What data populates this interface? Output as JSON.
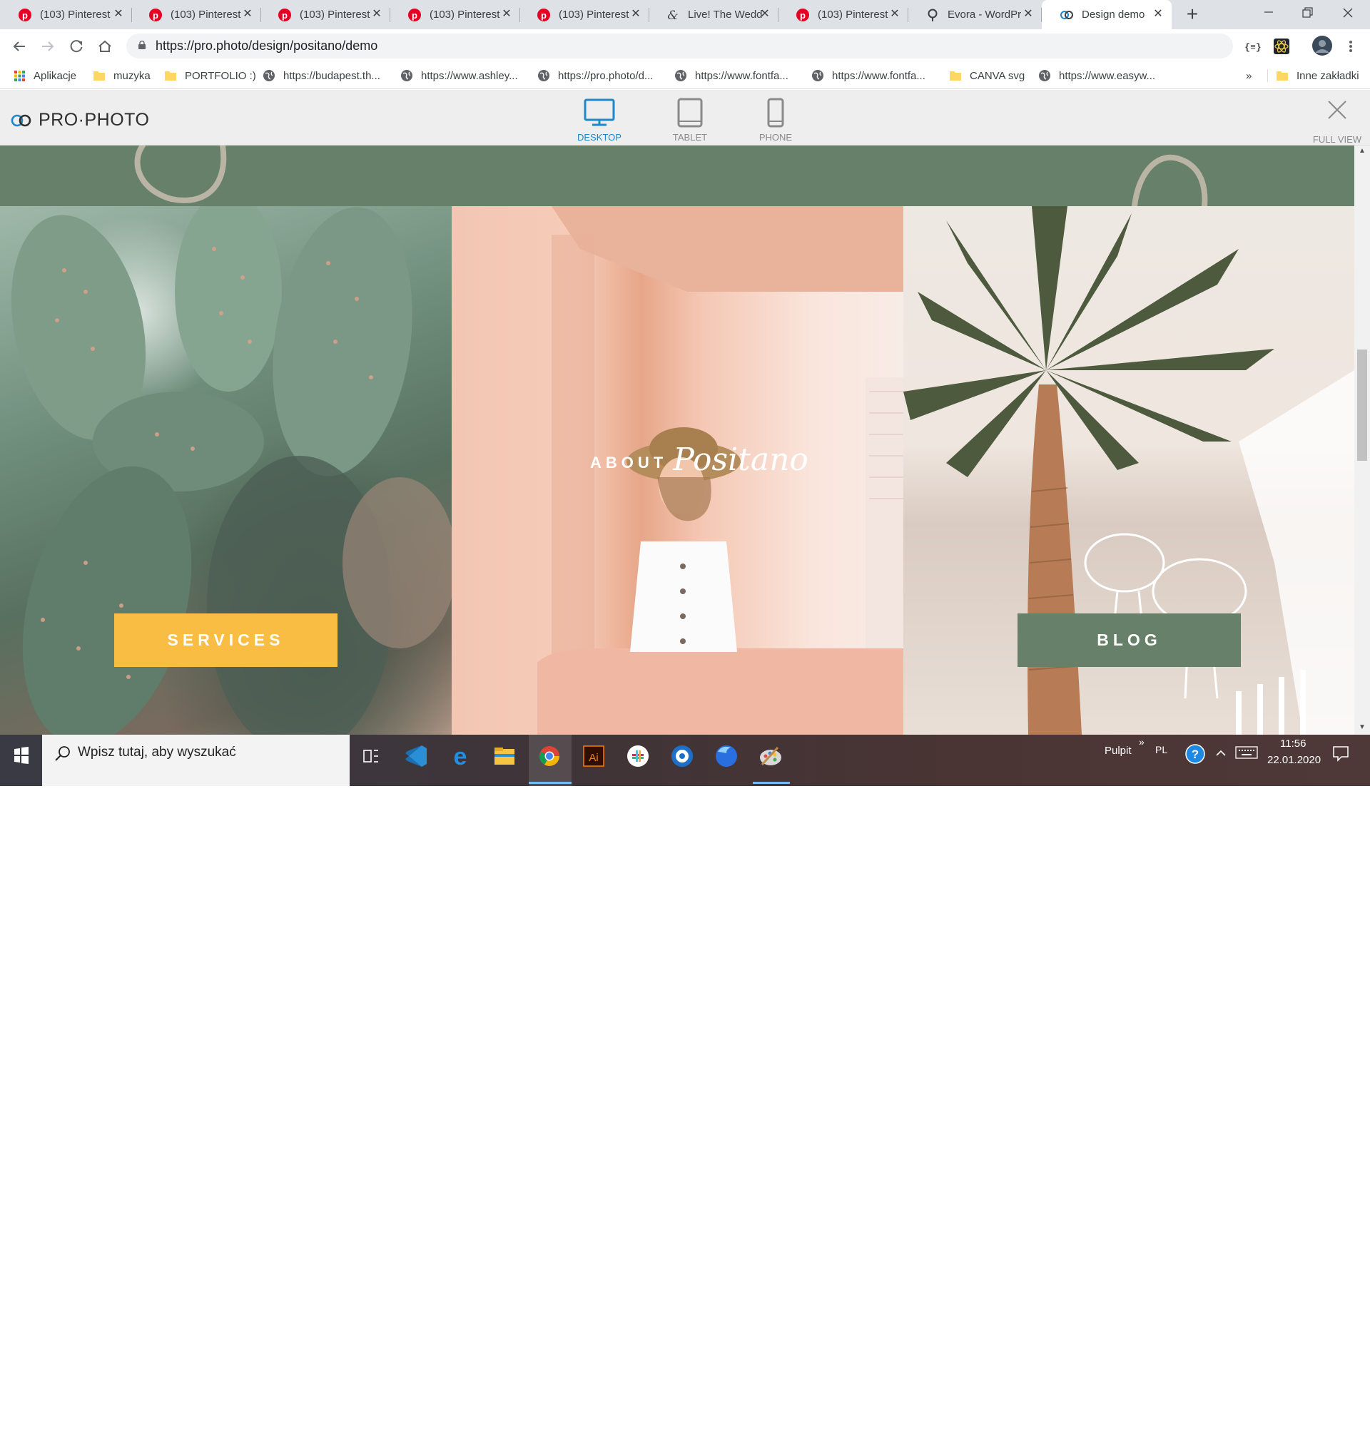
{
  "browser": {
    "tabs": [
      {
        "title": "(103) Pinterest",
        "icon": "pinterest-icon"
      },
      {
        "title": "(103) Pinterest",
        "icon": "pinterest-icon"
      },
      {
        "title": "(103) Pinterest",
        "icon": "pinterest-icon"
      },
      {
        "title": "(103) Pinterest",
        "icon": "pinterest-icon"
      },
      {
        "title": "(103) Pinterest",
        "icon": "pinterest-icon"
      },
      {
        "title": "Live! The Wedd",
        "icon": "ampersand-icon"
      },
      {
        "title": "(103) Pinterest",
        "icon": "pinterest-icon"
      },
      {
        "title": "Evora - WordPr",
        "icon": "location-pin-icon"
      },
      {
        "title": "Design demo",
        "icon": "prophoto-link-icon",
        "active": true
      }
    ],
    "url": "https://pro.photo/design/positano/demo",
    "bookmarks": [
      {
        "label": "Aplikacje",
        "icon": "apps-grid-icon"
      },
      {
        "label": "muzyka",
        "icon": "folder-icon"
      },
      {
        "label": "PORTFOLIO :)",
        "icon": "folder-icon"
      },
      {
        "label": "https://budapest.th...",
        "icon": "globe-icon"
      },
      {
        "label": "https://www.ashley...",
        "icon": "globe-icon"
      },
      {
        "label": "https://pro.photo/d...",
        "icon": "globe-icon"
      },
      {
        "label": "https://www.fontfa...",
        "icon": "globe-icon"
      },
      {
        "label": "https://www.fontfa...",
        "icon": "globe-icon"
      },
      {
        "label": "CANVA svg",
        "icon": "folder-icon"
      },
      {
        "label": "https://www.easyw...",
        "icon": "globe-icon"
      }
    ],
    "more_bookmarks": "»",
    "other_bookmarks": "Inne zakładki"
  },
  "preview": {
    "logo": "PRO·PHOTO",
    "devices": [
      {
        "label": "DESKTOP",
        "active": true
      },
      {
        "label": "TABLET",
        "active": false
      },
      {
        "label": "PHONE",
        "active": false
      }
    ],
    "full_view": "FULL VIEW"
  },
  "site": {
    "services_button": "SERVICES",
    "about_label": "ABOUT",
    "about_script": "Positano",
    "blog_button": "BLOG",
    "colors": {
      "green": "#67806a",
      "yellow": "#f8bd42"
    }
  },
  "taskbar": {
    "search_placeholder": "Wpisz tutaj, aby wyszukać",
    "desktop_label": "Pulpit",
    "chevron": "»",
    "language": "PL",
    "time": "11:56",
    "date": "22.01.2020"
  }
}
